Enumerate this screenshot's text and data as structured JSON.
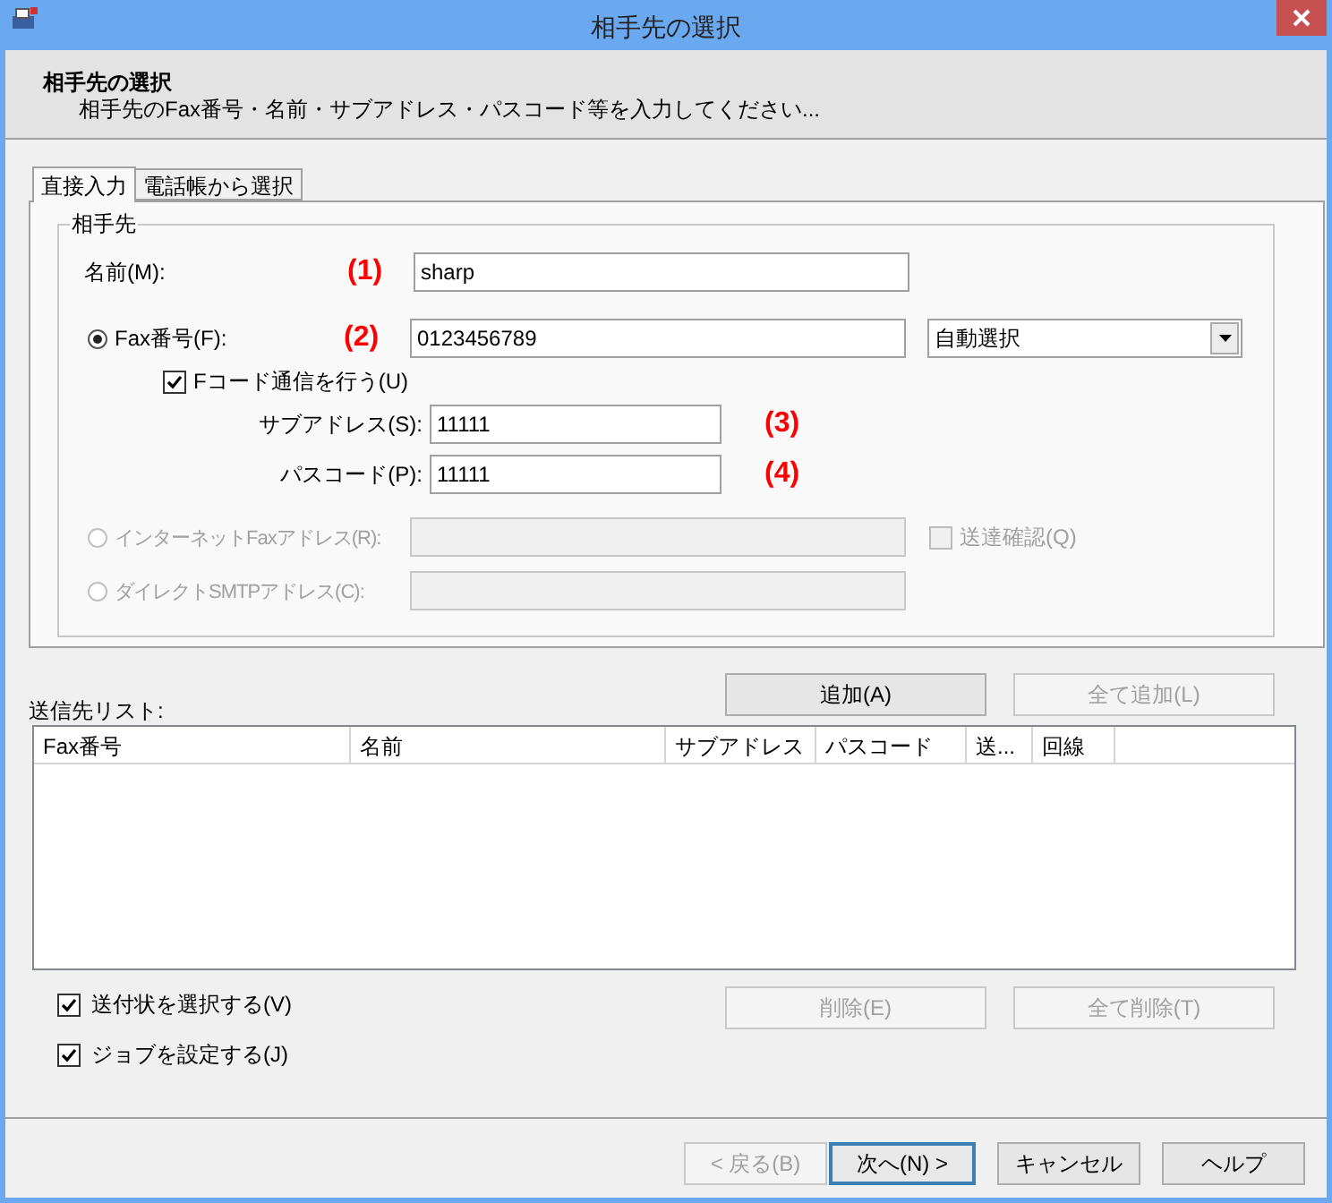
{
  "window": {
    "title": "相手先の選択"
  },
  "header": {
    "title": "相手先の選択",
    "subtitle": "相手先のFax番号・名前・サブアドレス・パスコード等を入力してください..."
  },
  "tabs": [
    {
      "label": "直接入力",
      "selected": true
    },
    {
      "label": "電話帳から選択",
      "selected": false
    }
  ],
  "group": {
    "title": "相手先",
    "name": {
      "label": "名前(M):",
      "marker": "(1)",
      "value": "sharp"
    },
    "fax": {
      "label": "Fax番号(F):",
      "selected": true,
      "marker": "(2)",
      "value": "0123456789",
      "line_select": "自動選択"
    },
    "fcode": {
      "label": "Fコード通信を行う(U)",
      "checked": true
    },
    "subaddress": {
      "label": "サブアドレス(S):",
      "value": "11111",
      "marker": "(3)"
    },
    "passcode": {
      "label": "パスコード(P):",
      "value": "11111",
      "marker": "(4)"
    },
    "internet_fax": {
      "label": "インターネットFaxアドレス(R):",
      "selected": false,
      "disabled": true
    },
    "delivery_confirm": {
      "label": "送達確認(Q)",
      "checked": false,
      "disabled": true
    },
    "direct_smtp": {
      "label": "ダイレクトSMTPアドレス(C):",
      "selected": false,
      "disabled": true
    }
  },
  "list": {
    "label": "送信先リスト:",
    "columns": [
      "Fax番号",
      "名前",
      "サブアドレス",
      "パスコード",
      "送...",
      "回線"
    ]
  },
  "list_buttons": [
    {
      "label": "追加(A)",
      "disabled": false
    },
    {
      "label": "全て追加(L)",
      "disabled": true
    }
  ],
  "options": [
    {
      "label": "送付状を選択する(V)",
      "checked": true
    },
    {
      "label": "ジョブを設定する(J)",
      "checked": true
    }
  ],
  "delete_buttons": [
    {
      "label": "削除(E)",
      "disabled": true
    },
    {
      "label": "全て削除(T)",
      "disabled": true
    }
  ],
  "footer_buttons": [
    {
      "label": "< 戻る(B)",
      "disabled": true,
      "default": false
    },
    {
      "label": "次へ(N) >",
      "disabled": false,
      "default": true
    },
    {
      "label": "キャンセル",
      "disabled": false,
      "default": false
    },
    {
      "label": "ヘルプ",
      "disabled": false,
      "default": false
    }
  ]
}
